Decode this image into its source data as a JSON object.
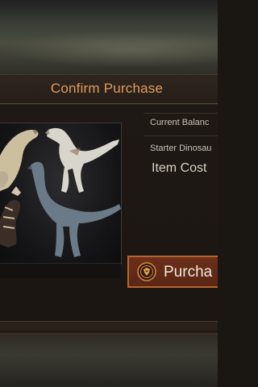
{
  "dialog": {
    "title": "Confirm Purchase",
    "current_balance_label": "Current Balanc",
    "item_name_label": "Starter Dinosau",
    "item_cost_label": "Item Cost",
    "purchase_button_label": "Purcha",
    "purchase_icon": "dinosaur-emblem-icon"
  },
  "artwork": {
    "subject": "starter-dinosaur-pack-art",
    "creatures": [
      "dinosaur-left",
      "dinosaur-top-right",
      "dinosaur-center",
      "dinosaur-bottom-left"
    ]
  },
  "colors": {
    "title": "#e39a5a",
    "button_fill": "#6b2f1b",
    "button_border": "#b5662f",
    "panel": "#1f1915"
  }
}
